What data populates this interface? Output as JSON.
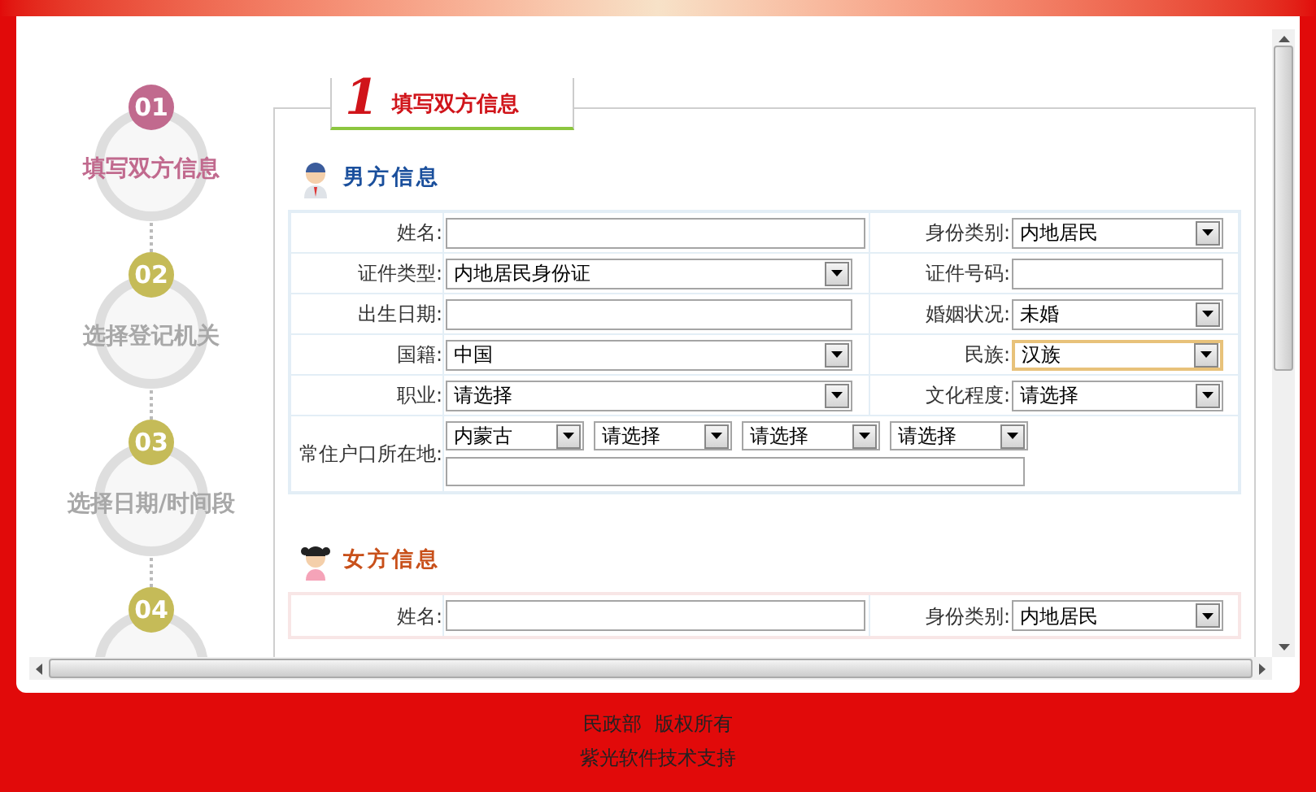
{
  "steps": [
    {
      "number": "01",
      "label": "填写双方信息",
      "selected": true
    },
    {
      "number": "02",
      "label": "选择登记机关",
      "selected": false
    },
    {
      "number": "03",
      "label": "选择日期/时间段",
      "selected": false
    },
    {
      "number": "04",
      "selected": false
    }
  ],
  "panel_tab": {
    "number": "1",
    "title": "填写双方信息"
  },
  "sections": [
    {
      "kind": "male",
      "title": "男方信息",
      "rows": [
        {
          "kind": "pair",
          "fields": [
            {
              "label": "姓名:",
              "kind": "text",
              "focused": false
            },
            {
              "label": "身份类别:",
              "kind": "select",
              "value": "内地居民",
              "focused": false
            }
          ]
        },
        {
          "kind": "pair",
          "fields": [
            {
              "label": "证件类型:",
              "kind": "select",
              "value": "内地居民身份证",
              "focused": false
            },
            {
              "label": "证件号码:",
              "kind": "text",
              "focused": false
            }
          ]
        },
        {
          "kind": "pair",
          "fields": [
            {
              "label": "出生日期:",
              "kind": "text",
              "focused": false
            },
            {
              "label": "婚姻状况:",
              "kind": "select",
              "value": "未婚",
              "focused": false
            }
          ]
        },
        {
          "kind": "pair",
          "fields": [
            {
              "label": "国籍:",
              "kind": "select",
              "value": "中国",
              "focused": false
            },
            {
              "label": "民族:",
              "kind": "select",
              "value": "汉族",
              "focused": true
            }
          ]
        },
        {
          "kind": "pair",
          "fields": [
            {
              "label": "职业:",
              "kind": "select",
              "value": "请选择",
              "focused": false
            },
            {
              "label": "文化程度:",
              "kind": "select",
              "value": "请选择",
              "focused": false
            }
          ]
        },
        {
          "kind": "address",
          "label": "常住户口所在地:",
          "selects": [
            "内蒙古",
            "请选择",
            "请选择",
            "请选择"
          ]
        }
      ]
    },
    {
      "kind": "female",
      "title": "女方信息",
      "rows": [
        {
          "kind": "pair",
          "fields": [
            {
              "label": "姓名:",
              "kind": "text",
              "focused": false
            },
            {
              "label": "身份类别:",
              "kind": "select",
              "value": "内地居民",
              "focused": false
            }
          ]
        }
      ]
    }
  ],
  "footer": [
    "民政部  版权所有",
    "紫光软件技术支持"
  ]
}
